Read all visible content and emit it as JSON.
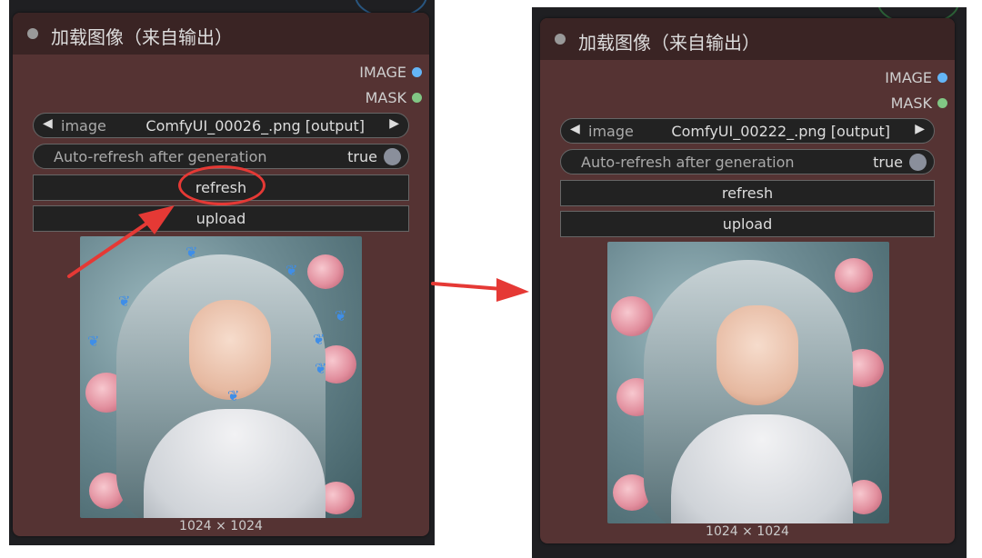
{
  "panels": [
    {
      "title": "加载图像（来自输出）",
      "outputs": {
        "image": "IMAGE",
        "mask": "MASK"
      },
      "combo": {
        "name": "image",
        "value": "ComfyUI_00026_.png [output]"
      },
      "toggle": {
        "label": "Auto-refresh after generation",
        "value": "true"
      },
      "buttons": {
        "refresh": "refresh",
        "upload": "upload"
      },
      "image_size": "1024 × 1024"
    },
    {
      "title": "加载图像（来自输出）",
      "outputs": {
        "image": "IMAGE",
        "mask": "MASK"
      },
      "combo": {
        "name": "image",
        "value": "ComfyUI_00222_.png [output]"
      },
      "toggle": {
        "label": "Auto-refresh after generation",
        "value": "true"
      },
      "buttons": {
        "refresh": "refresh",
        "upload": "upload"
      },
      "image_size": "1024 × 1024"
    }
  ],
  "colors": {
    "annotation": "#e53935",
    "node_body": "#553333",
    "node_title": "#3a2424",
    "image_slot": "#64b5f6",
    "mask_slot": "#81c784"
  },
  "icons": {
    "combo_prev": "triangle-left-icon",
    "combo_next": "triangle-right-icon",
    "status_dot": "node-status-dot",
    "annotation_arrow": "red-arrow"
  }
}
